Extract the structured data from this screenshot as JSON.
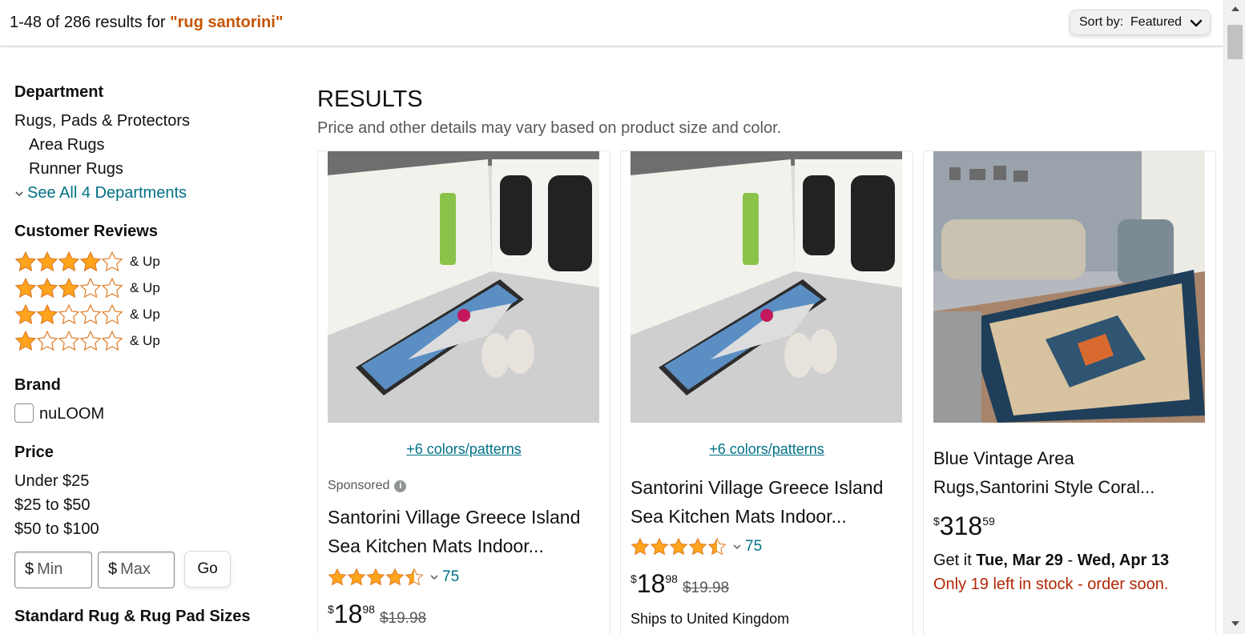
{
  "header": {
    "result_range": "1-48 of 286 results for ",
    "query": "\"rug santorini\"",
    "sort_label": "Sort by:",
    "sort_value": "Featured"
  },
  "sidebar": {
    "department": {
      "heading": "Department",
      "items": [
        "Rugs, Pads & Protectors",
        "Area Rugs",
        "Runner Rugs"
      ],
      "see_all": "See All 4 Departments"
    },
    "reviews": {
      "heading": "Customer Reviews",
      "rows": [
        {
          "stars": 4,
          "label": "& Up"
        },
        {
          "stars": 3,
          "label": "& Up"
        },
        {
          "stars": 2,
          "label": "& Up"
        },
        {
          "stars": 1,
          "label": "& Up"
        }
      ]
    },
    "brand": {
      "heading": "Brand",
      "options": [
        "nuLOOM"
      ]
    },
    "price": {
      "heading": "Price",
      "ranges": [
        "Under $25",
        "$25 to $50",
        "$50 to $100"
      ],
      "currency": "$",
      "min_placeholder": "Min",
      "max_placeholder": "Max",
      "go_label": "Go"
    },
    "sizes": {
      "heading": "Standard Rug & Rug Pad Sizes"
    }
  },
  "main": {
    "title": "RESULTS",
    "subtitle": "Price and other details may vary based on product size and color."
  },
  "products": [
    {
      "variants": "+6 colors/patterns",
      "sponsored": "Sponsored",
      "title_line1": "Santorini Village Greece Island",
      "title_line2": "Sea Kitchen Mats Indoor...",
      "rating": 4.5,
      "reviews": "75",
      "currency": "$",
      "price_whole": "18",
      "price_frac": "98",
      "was_price": "$19.98"
    },
    {
      "variants": "+6 colors/patterns",
      "title_line1": "Santorini Village Greece Island",
      "title_line2": "Sea Kitchen Mats Indoor...",
      "rating": 4.5,
      "reviews": "75",
      "currency": "$",
      "price_whole": "18",
      "price_frac": "98",
      "was_price": "$19.98",
      "shipping": "Ships to United Kingdom"
    },
    {
      "title_line1": "Blue Vintage Area",
      "title_line2": "Rugs,Santorini Style Coral...",
      "currency": "$",
      "price_whole": "318",
      "price_frac": "59",
      "delivery_prefix": "Get it ",
      "delivery_date1": "Tue, Mar 29",
      "delivery_sep": " - ",
      "delivery_date2": "Wed, Apr 13",
      "stock": "Only 19 left in stock - order soon."
    }
  ],
  "colors": {
    "star": "#ffa41c",
    "link": "#007185",
    "query": "#c45500",
    "stock": "#b12704"
  }
}
